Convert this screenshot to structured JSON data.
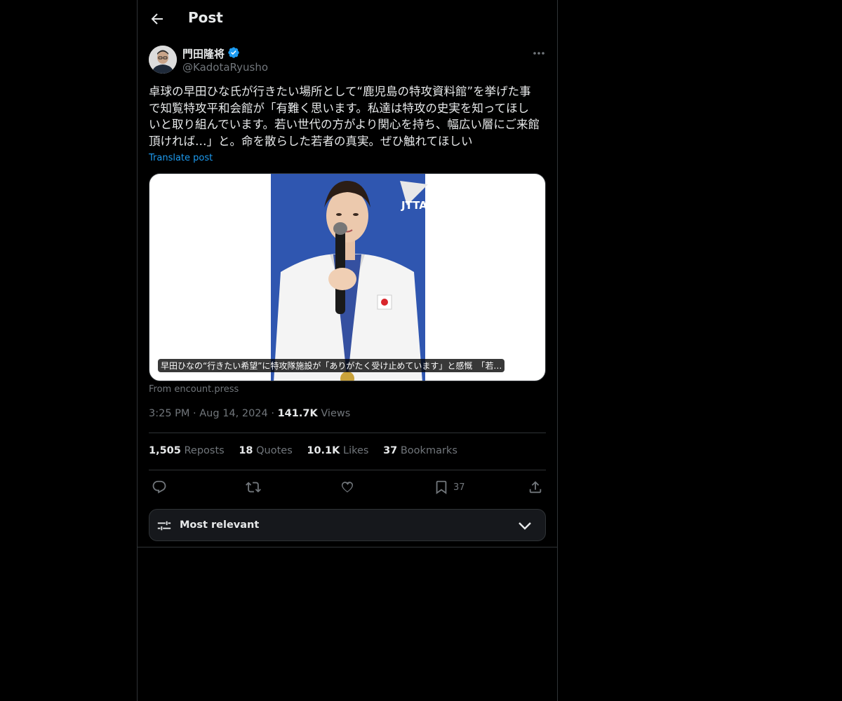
{
  "header": {
    "title": "Post"
  },
  "author": {
    "name": "門田隆将",
    "handle": "@KadotaRyusho"
  },
  "post": {
    "text": "卓球の早田ひな氏が行きたい場所として“鹿児島の特攻資料館”を挙げた事\nで知覧特攻平和会館が「有難く思います。私達は特攻の史実を知ってほし\nいと取り組んでいます。若い世代の方がより関心を持ち、幅広い層にご来館\n頂ければ…」と。命を散らした若者の真実。ぜひ触れてほしい",
    "translate_label": "Translate post"
  },
  "card": {
    "caption": "早田ひなの“行きたい希望”に特攻隊施設が「ありがたく受け止めています」と感慨　「若…",
    "from": "From encount.press",
    "sponsor_text": "JTTA"
  },
  "meta": {
    "time": "3:25 PM",
    "date": "Aug 14, 2024",
    "views_count": "141.7K",
    "views_label": "Views"
  },
  "stats": [
    {
      "count": "1,505",
      "label": "Reposts"
    },
    {
      "count": "18",
      "label": "Quotes"
    },
    {
      "count": "10.1K",
      "label": "Likes"
    },
    {
      "count": "37",
      "label": "Bookmarks"
    }
  ],
  "actions": {
    "bookmark_count": "37"
  },
  "sort": {
    "label": "Most relevant"
  },
  "colors": {
    "accent": "#1d9bf0",
    "background": "#000000",
    "muted": "#71767b",
    "text": "#e7e9ea"
  },
  "icons": [
    "back-arrow-icon",
    "verified-badge-icon",
    "more-icon",
    "reply-icon",
    "repost-icon",
    "like-icon",
    "bookmark-icon",
    "share-icon",
    "sort-settings-icon",
    "chevron-down-icon"
  ]
}
